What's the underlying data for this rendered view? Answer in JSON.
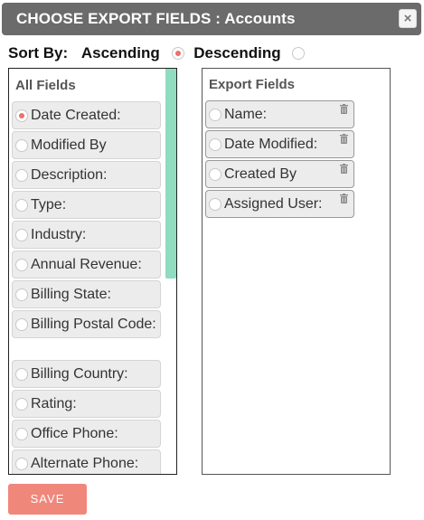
{
  "dialog": {
    "title": "CHOOSE EXPORT FIELDS : Accounts",
    "close_label": "×"
  },
  "sort": {
    "label": "Sort By:",
    "options": [
      {
        "label": "Ascending",
        "checked": true
      },
      {
        "label": "Descending",
        "checked": false
      }
    ]
  },
  "all_fields": {
    "title": "All Fields",
    "items": [
      {
        "label": "Date Created:",
        "selected": true
      },
      {
        "label": "Modified By",
        "selected": false
      },
      {
        "label": "Description:",
        "selected": false
      },
      {
        "label": "Type:",
        "selected": false
      },
      {
        "label": "Industry:",
        "selected": false
      },
      {
        "label": "Annual Revenue:",
        "selected": false
      },
      {
        "label": "Billing State:",
        "selected": false
      },
      {
        "label": "Billing Postal Code:",
        "selected": false
      },
      {
        "label": "Billing Country:",
        "selected": false
      },
      {
        "label": "Rating:",
        "selected": false
      },
      {
        "label": "Office Phone:",
        "selected": false
      },
      {
        "label": "Alternate Phone:",
        "selected": false
      }
    ]
  },
  "export_fields": {
    "title": "Export Fields",
    "items": [
      {
        "label": "Name:"
      },
      {
        "label": "Date Modified:"
      },
      {
        "label": "Created By"
      },
      {
        "label": "Assigned User:"
      }
    ]
  },
  "actions": {
    "save_label": "SAVE"
  },
  "colors": {
    "titlebar": "#6b6b6b",
    "accent": "#ef6f6c",
    "save_button": "#f0877b",
    "scrollbar": "#8fdcc0"
  }
}
